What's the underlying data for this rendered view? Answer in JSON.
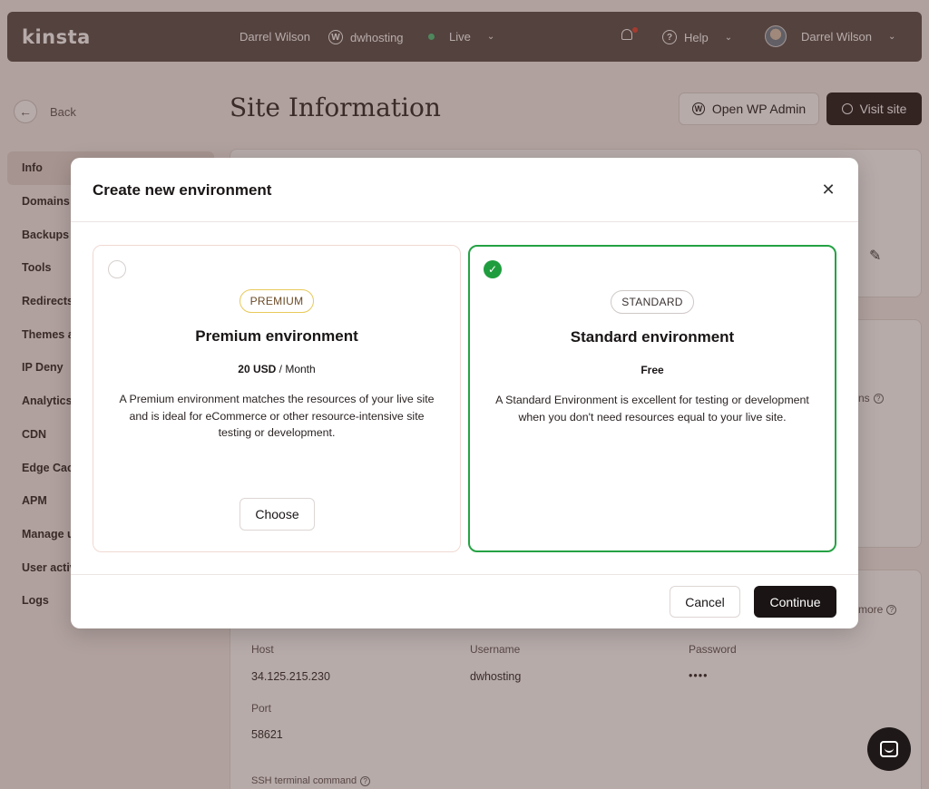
{
  "topbar": {
    "logo": "kinsta",
    "user_name": "Darrel Wilson",
    "site_name": "dwhosting",
    "environment": "Live",
    "help_label": "Help",
    "account_name": "Darrel Wilson"
  },
  "page": {
    "back_label": "Back",
    "title": "Site Information",
    "open_wp_admin_label": "Open WP Admin",
    "visit_site_label": "Visit site"
  },
  "sidebar": {
    "items": [
      {
        "label": "Info"
      },
      {
        "label": "Domains"
      },
      {
        "label": "Backups"
      },
      {
        "label": "Tools"
      },
      {
        "label": "Redirects"
      },
      {
        "label": "Themes a"
      },
      {
        "label": "IP Deny"
      },
      {
        "label": "Analytics"
      },
      {
        "label": "CDN"
      },
      {
        "label": "Edge Cac"
      },
      {
        "label": "APM"
      },
      {
        "label": "Manage u"
      },
      {
        "label": "User activ"
      },
      {
        "label": "Logs"
      }
    ]
  },
  "background": {
    "card2_fragment": "ns",
    "card3_fragment": "more",
    "host_label": "Host",
    "host_value": "34.125.215.230",
    "username_label": "Username",
    "username_value": "dwhosting",
    "password_label": "Password",
    "password_value": "••••",
    "port_label": "Port",
    "port_value": "58621",
    "ssh_label": "SSH terminal command"
  },
  "modal": {
    "title": "Create new environment",
    "options": [
      {
        "tag": "PREMIUM",
        "title": "Premium environment",
        "price_amount": "20 USD",
        "price_period": " / Month",
        "description": "A Premium environment matches the resources of your live site and is ideal for eCommerce or other resource-intensive site testing or development.",
        "choose_label": "Choose",
        "selected": false
      },
      {
        "tag": "STANDARD",
        "title": "Standard environment",
        "price_amount": "Free",
        "description": "A Standard Environment is excellent for testing or development when you don't need resources equal to your live site.",
        "selected": true
      }
    ],
    "cancel_label": "Cancel",
    "continue_label": "Continue"
  },
  "colors": {
    "accent_green": "#25a244",
    "dark": "#1a1414",
    "topbar": "#564a48",
    "premium_pill_border": "#e8c95a"
  }
}
